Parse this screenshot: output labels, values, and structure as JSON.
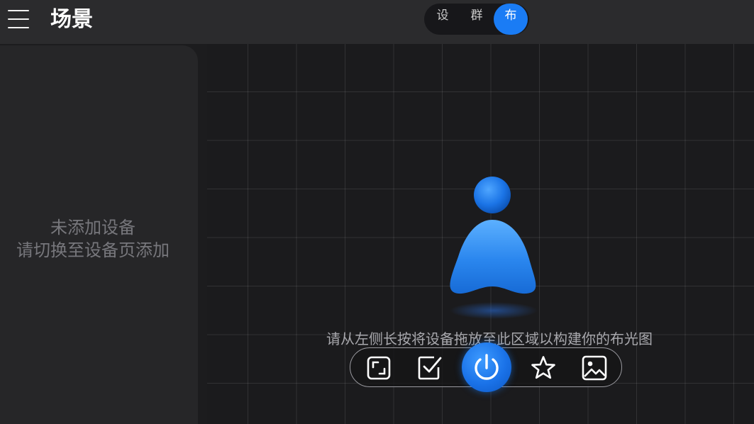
{
  "header": {
    "title": "场景",
    "segments": [
      {
        "label": "设",
        "active": false
      },
      {
        "label": "群",
        "active": false
      },
      {
        "label": "布",
        "active": true
      }
    ]
  },
  "sidebar": {
    "empty_line1": "未添加设备",
    "empty_line2": "请切换至设备页添加"
  },
  "canvas": {
    "hint": "请从左侧长按将设备拖放至此区域以构建你的布光图"
  },
  "toolbar": {
    "items": [
      {
        "icon": "fullscreen-icon"
      },
      {
        "icon": "checkbox-icon"
      },
      {
        "icon": "power-icon"
      },
      {
        "icon": "star-icon"
      },
      {
        "icon": "image-icon"
      }
    ]
  },
  "colors": {
    "accent": "#1a7cf5",
    "background": "#1c1c1e",
    "panel": "#262628",
    "topbar": "#2b2b2d"
  }
}
